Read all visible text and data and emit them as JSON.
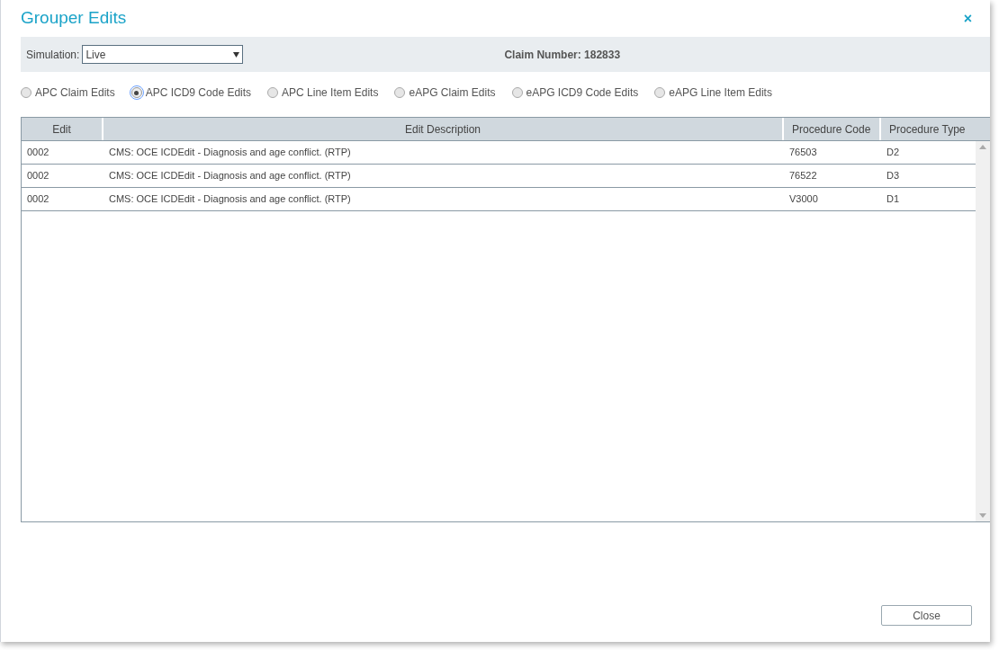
{
  "dialog": {
    "title": "Grouper Edits",
    "close_glyph": "×"
  },
  "toolbar": {
    "simulation_label": "Simulation:",
    "simulation_value": "Live",
    "claim_number": "Claim Number: 182833"
  },
  "options": [
    {
      "label": "APC Claim Edits",
      "selected": false
    },
    {
      "label": "APC ICD9 Code Edits",
      "selected": true
    },
    {
      "label": "APC Line Item Edits",
      "selected": false
    },
    {
      "label": "eAPG Claim Edits",
      "selected": false
    },
    {
      "label": "eAPG ICD9 Code Edits",
      "selected": false
    },
    {
      "label": "eAPG Line Item Edits",
      "selected": false
    }
  ],
  "table": {
    "columns": [
      "Edit",
      "Edit Description",
      "Procedure Code",
      "Procedure Type"
    ],
    "rows": [
      [
        "0002",
        "CMS: OCE ICDEdit - Diagnosis and age conflict. (RTP)",
        "76503",
        "D2"
      ],
      [
        "0002",
        "CMS: OCE ICDEdit - Diagnosis and age conflict. (RTP)",
        "76522",
        "D3"
      ],
      [
        "0002",
        "CMS: OCE ICDEdit - Diagnosis and age conflict. (RTP)",
        "V3000",
        "D1"
      ]
    ]
  },
  "buttons": [
    "Close"
  ]
}
